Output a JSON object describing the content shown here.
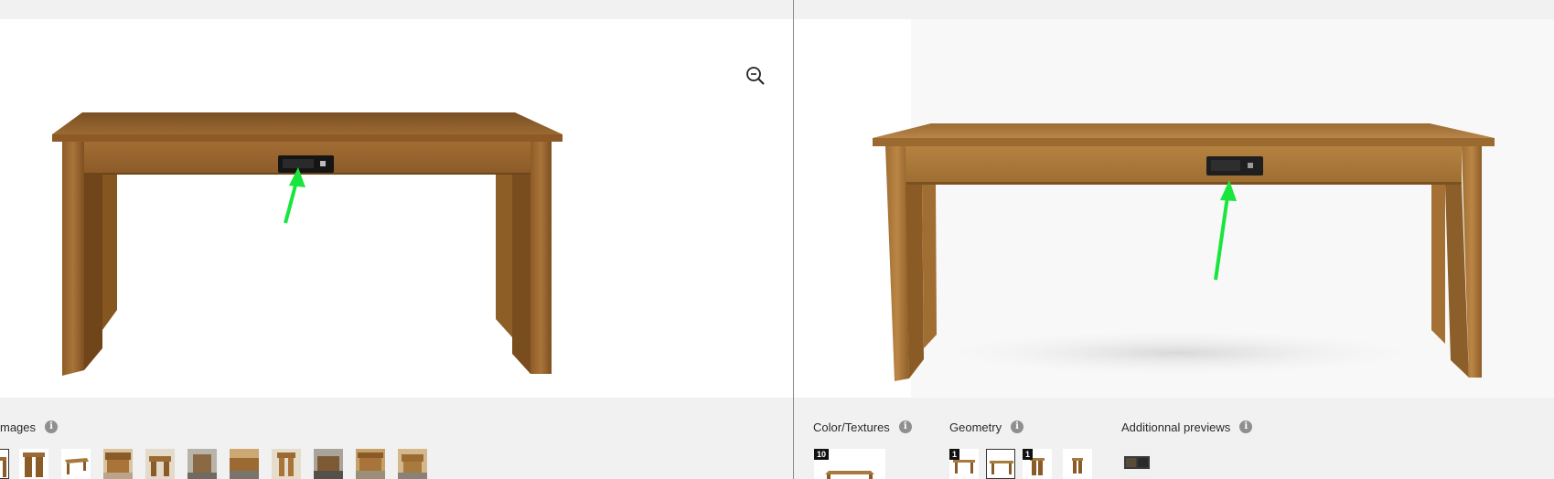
{
  "left": {
    "images_label": "mages",
    "thumbnails": [
      "table-side",
      "table-end",
      "table-angle",
      "room-1",
      "room-2",
      "room-3",
      "room-4",
      "room-5",
      "room-6",
      "room-7",
      "room-8"
    ]
  },
  "right": {
    "color_label": "Color/Textures",
    "color_count": "10",
    "geometry_label": "Geometry",
    "geometry_badge_1": "1",
    "geometry_badge_2": "1",
    "previews_label": "Additionnal previews"
  },
  "icons": {
    "zoom": "zoom-out-icon",
    "info": "info-icon",
    "arrow": "arrow-icon"
  },
  "colors": {
    "arrow": "#19e63c",
    "wood_dark": "#8a5a24",
    "wood_light": "#a87a3e",
    "panel_bg": "#f1f1f1"
  }
}
